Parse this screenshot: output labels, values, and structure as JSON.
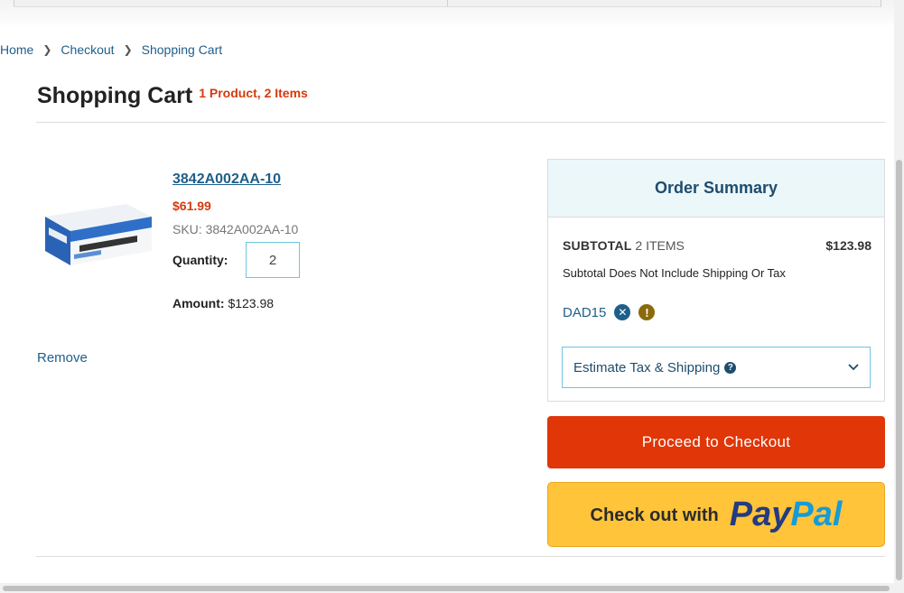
{
  "breadcrumb": {
    "items": [
      "Home",
      "Checkout",
      "Shopping Cart"
    ]
  },
  "page": {
    "title": "Shopping Cart",
    "count": "1 Product, 2 Items"
  },
  "item": {
    "name": "3842A002AA-10",
    "price": "$61.99",
    "sku": "SKU: 3842A002AA-10",
    "quantity_label": "Quantity:",
    "quantity": "2",
    "amount_label": "Amount:",
    "amount": "$123.98",
    "remove_label": "Remove"
  },
  "summary": {
    "title": "Order Summary",
    "subtotal_label": "SUBTOTAL",
    "subtotal_items": "2 ITEMS",
    "subtotal_value": "$123.98",
    "note": "Subtotal Does Not Include Shipping Or Tax",
    "coupon_code": "DAD15",
    "estimate_label": "Estimate Tax & Shipping"
  },
  "actions": {
    "checkout_label": "Proceed to Checkout",
    "paypal_prefix": "Check out with",
    "paypal_brand_1": "Pay",
    "paypal_brand_2": "Pal"
  },
  "colors": {
    "accent": "#e03608",
    "link": "#1e5f8a",
    "price": "#d63a0c",
    "paypal": "#ffc43a"
  }
}
